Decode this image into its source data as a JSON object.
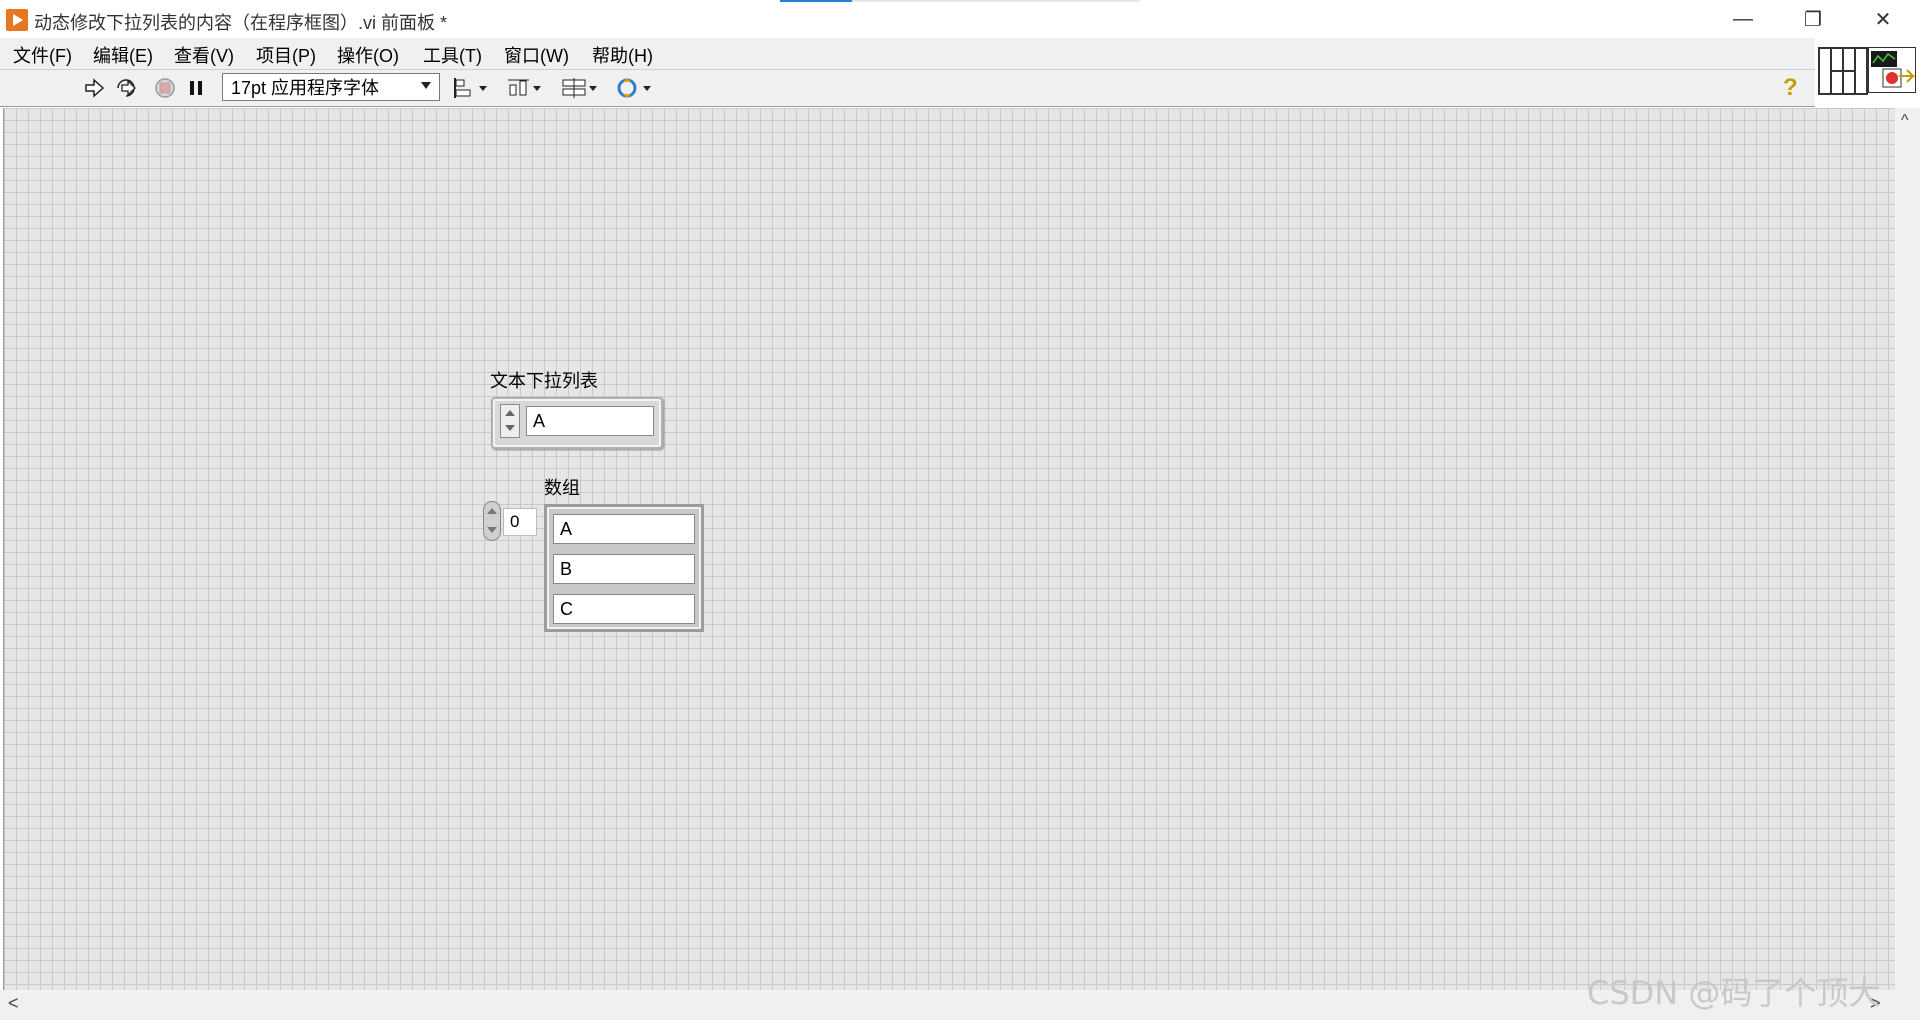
{
  "window": {
    "title": "动态修改下拉列表的内容（在程序框图）.vi 前面板 *",
    "minimize_glyph": "—",
    "restore_glyph": "❐",
    "close_glyph": "✕"
  },
  "menu": {
    "items": [
      "文件(F)",
      "编辑(E)",
      "查看(V)",
      "项目(P)",
      "操作(O)",
      "工具(T)",
      "窗口(W)",
      "帮助(H)"
    ]
  },
  "toolbar": {
    "run_icon": "run-arrow-icon",
    "run_continuous_icon": "run-continuously-icon",
    "abort_icon": "abort-execution-icon",
    "pause_icon": "pause-icon",
    "font_select": "17pt 应用程序字体",
    "align_icon": "align-objects-icon",
    "distribute_icon": "distribute-objects-icon",
    "resize_icon": "resize-objects-icon",
    "reorder_icon": "reorder-icon",
    "help_glyph": "?"
  },
  "front_panel": {
    "text_ring": {
      "label": "文本下拉列表",
      "value": "A"
    },
    "array": {
      "label": "数组",
      "index": "0",
      "elements": [
        "A",
        "B",
        "C"
      ]
    }
  },
  "scrollbars": {
    "up_glyph": "^",
    "left_glyph": "<",
    "right_glyph": ">"
  },
  "watermark": "CSDN @码了个顶大"
}
